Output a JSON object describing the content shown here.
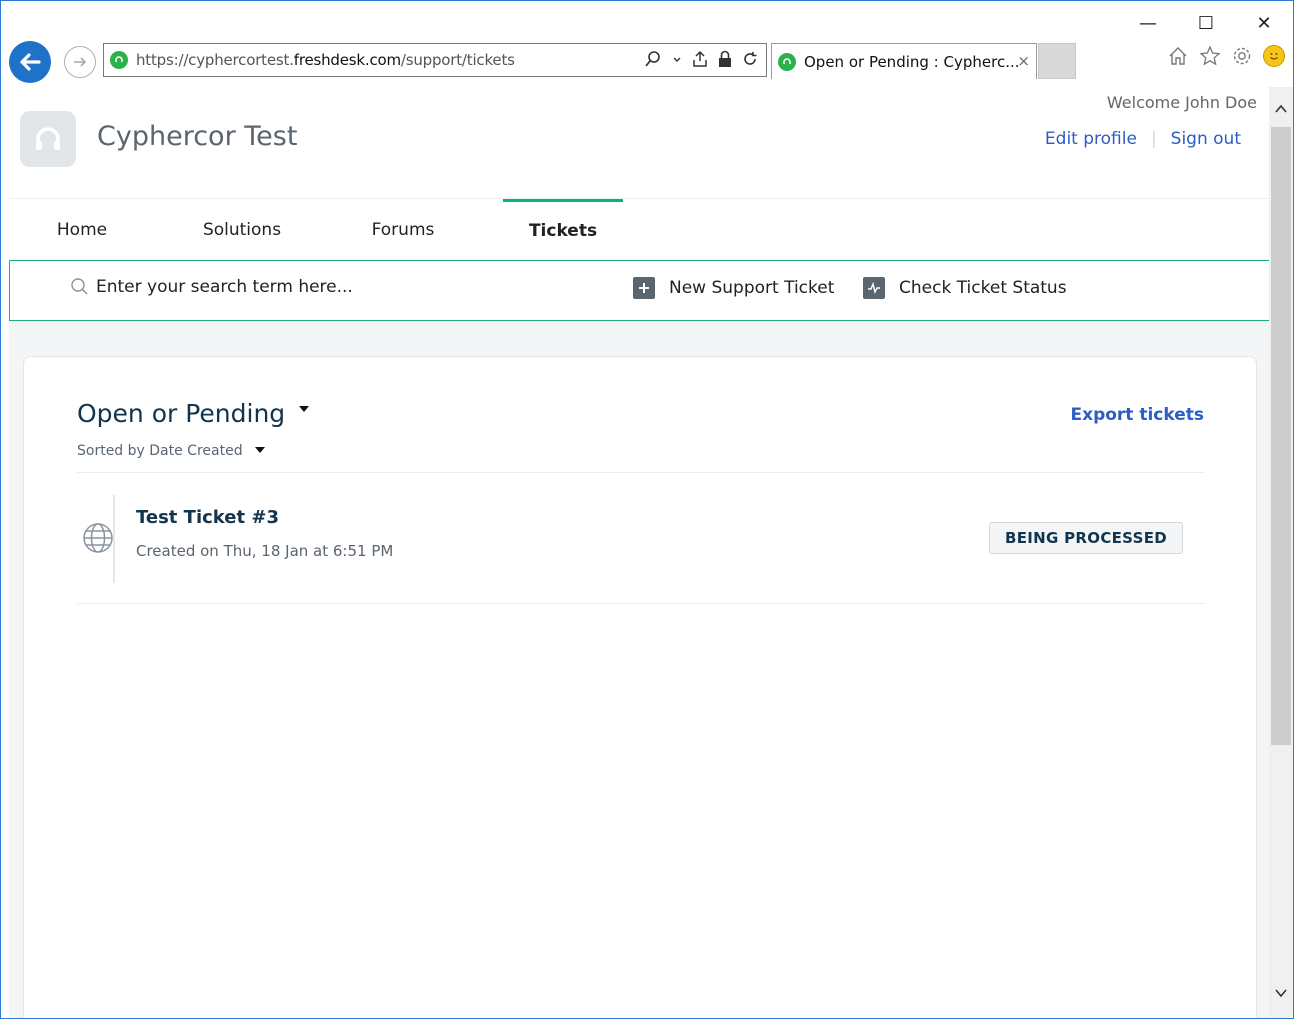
{
  "browser": {
    "url_prefix": "https://cyphercortest.",
    "url_domain": "freshdesk.com",
    "url_path": "/support/tickets",
    "tab_title": "Open or Pending : Cypherc...",
    "tab_close": "×",
    "win_minimize": "—",
    "win_maximize": "☐",
    "win_close": "✕"
  },
  "header": {
    "brand": "Cyphercor Test",
    "welcome": "Welcome John Doe",
    "edit_profile": "Edit profile",
    "sign_out": "Sign out"
  },
  "nav": {
    "items": [
      {
        "label": "Home"
      },
      {
        "label": "Solutions"
      },
      {
        "label": "Forums"
      },
      {
        "label": "Tickets"
      }
    ],
    "active": "Tickets"
  },
  "search": {
    "placeholder": "Enter your search term here..."
  },
  "actions": {
    "new_ticket": "New Support Ticket",
    "check_status": "Check Ticket Status"
  },
  "tickets": {
    "filter_title": "Open or Pending",
    "sort_label": "Sorted by Date Created",
    "export_label": "Export tickets",
    "rows": [
      {
        "title": "Test Ticket #3",
        "created": "Created on Thu, 18 Jan at 6:51 PM",
        "status": "BEING PROCESSED"
      }
    ]
  },
  "colors": {
    "accent_green": "#02b875",
    "link_blue": "#2c5cc5",
    "text_dark": "#12344d",
    "browser_blue": "#1e73c9"
  },
  "icons": [
    "back-arrow-icon",
    "forward-arrow-icon",
    "freshdesk-favicon",
    "search-icon",
    "home-icon",
    "star-icon",
    "gear-icon",
    "smiley-icon",
    "headset-icon",
    "plus-icon",
    "pulse-icon",
    "globe-icon",
    "caret-down-icon"
  ]
}
